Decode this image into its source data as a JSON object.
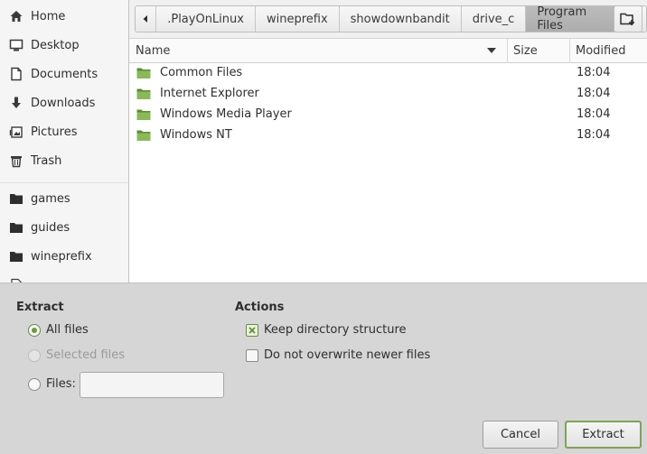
{
  "sidebar": {
    "items": [
      {
        "label": "Home",
        "icon": "home-icon"
      },
      {
        "label": "Desktop",
        "icon": "desktop-icon"
      },
      {
        "label": "Documents",
        "icon": "documents-icon"
      },
      {
        "label": "Downloads",
        "icon": "downloads-icon"
      },
      {
        "label": "Pictures",
        "icon": "pictures-icon"
      },
      {
        "label": "Trash",
        "icon": "trash-icon"
      }
    ],
    "bookmarks": [
      {
        "label": "games",
        "icon": "folder-icon"
      },
      {
        "label": "guides",
        "icon": "folder-icon"
      },
      {
        "label": "wineprefix",
        "icon": "folder-icon"
      }
    ]
  },
  "pathbar": {
    "crumbs": [
      ".PlayOnLinux",
      "wineprefix",
      "showdownbandit",
      "drive_c",
      "Program Files"
    ],
    "active": "Program Files"
  },
  "filelist": {
    "columns": {
      "name": "Name",
      "size": "Size",
      "modified": "Modified"
    },
    "rows": [
      {
        "name": "Common Files",
        "size": "",
        "modified": "18:04"
      },
      {
        "name": "Internet Explorer",
        "size": "",
        "modified": "18:04"
      },
      {
        "name": "Windows Media Player",
        "size": "",
        "modified": "18:04"
      },
      {
        "name": "Windows NT",
        "size": "",
        "modified": "18:04"
      }
    ]
  },
  "extract": {
    "title": "Extract",
    "all_files": "All files",
    "selected_files": "Selected files",
    "files_label": "Files:",
    "files_value": ""
  },
  "actions": {
    "title": "Actions",
    "keep_structure": "Keep directory structure",
    "keep_structure_checked": true,
    "no_overwrite": "Do not overwrite newer files",
    "no_overwrite_checked": false
  },
  "buttons": {
    "cancel": "Cancel",
    "extract": "Extract"
  },
  "colors": {
    "accent": "#7fa25a",
    "folder": "#7ba44c"
  }
}
